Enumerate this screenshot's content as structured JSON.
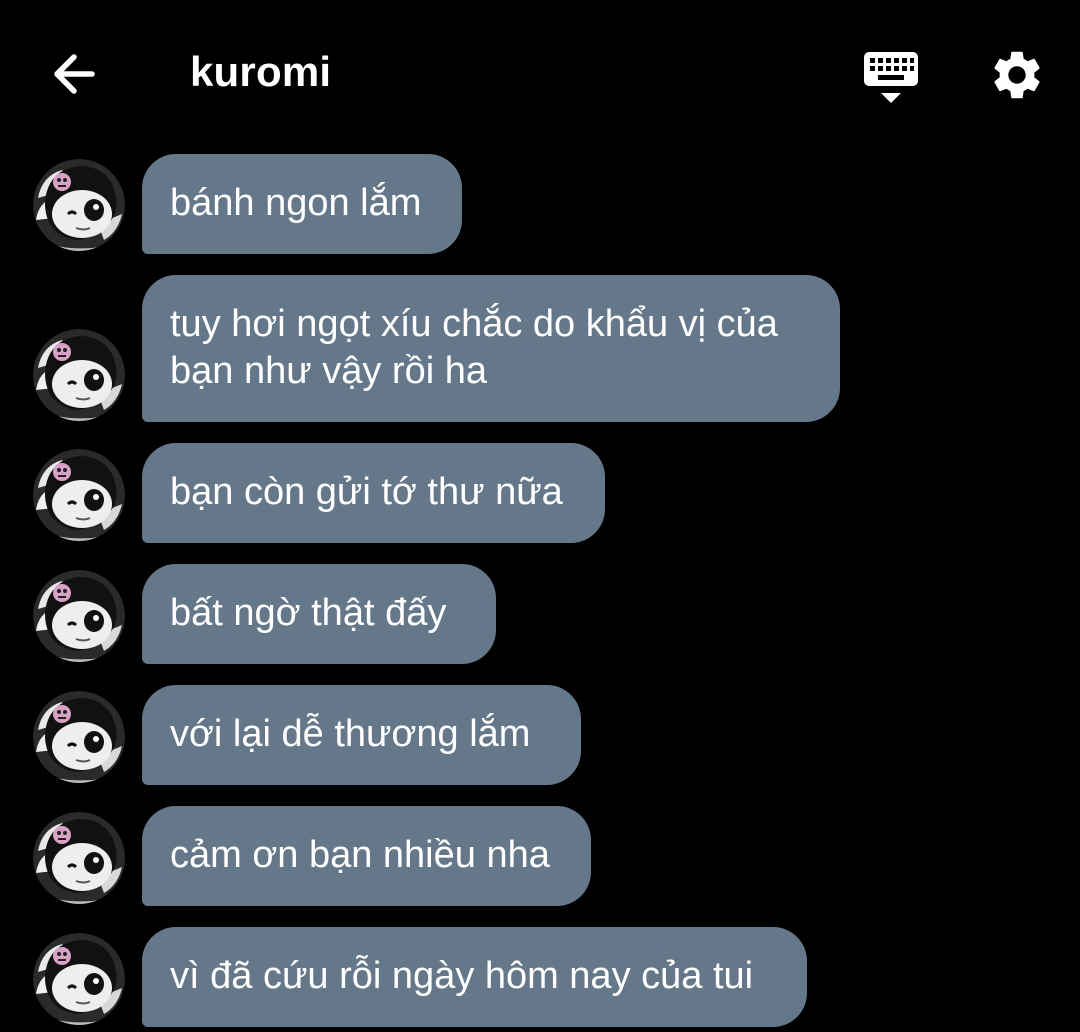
{
  "header": {
    "title": "kuromi",
    "icons": [
      "arrow-left-icon",
      "keyboard-icon",
      "gear-icon"
    ]
  },
  "colors": {
    "background": "#000000",
    "bubble": "#65788a",
    "text": "#ffffff"
  },
  "messages": [
    {
      "text": "bánh ngon lắm"
    },
    {
      "text": "tuy hơi ngọt xíu chắc do khẩu vị của\nbạn như vậy rồi ha"
    },
    {
      "text": "bạn còn gửi tớ thư nữa"
    },
    {
      "text": "bất ngờ thật đấy"
    },
    {
      "text": "với lại dễ thương lắm"
    },
    {
      "text": "cảm ơn bạn nhiều nha"
    },
    {
      "text": "vì đã cứu rỗi ngày hôm nay của tui"
    }
  ]
}
